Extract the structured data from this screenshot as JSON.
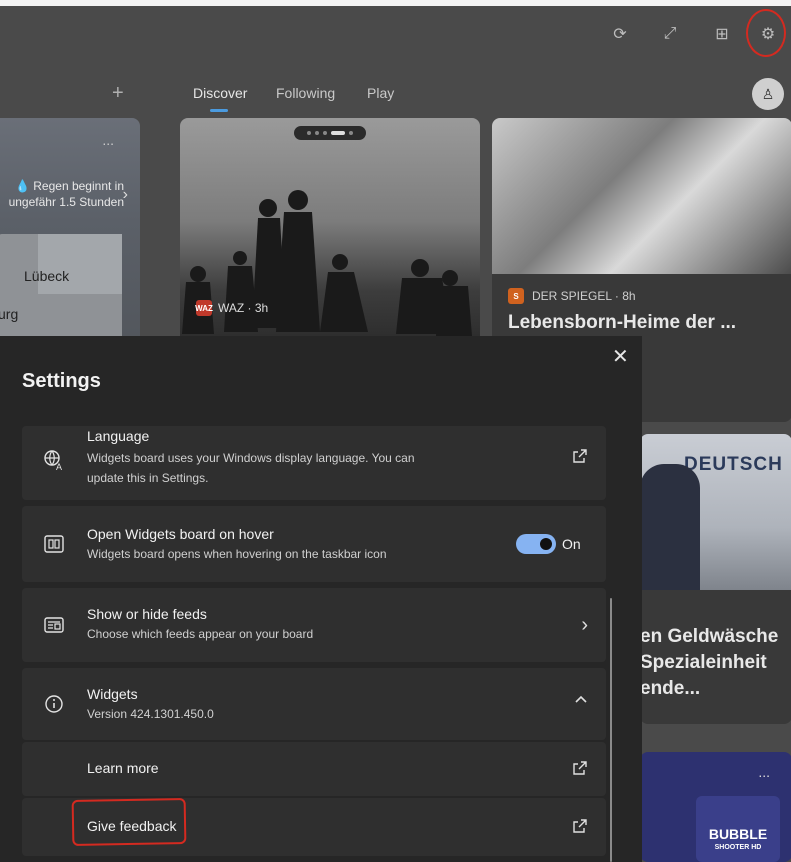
{
  "toolbar": {
    "icons": [
      "refresh-icon",
      "expand-icon",
      "widgets-icon",
      "gear-icon"
    ]
  },
  "tabs": [
    "Discover",
    "Following",
    "Play"
  ],
  "add_label": "+",
  "weather": {
    "rain_text_1": "💧 Regen beginnt in",
    "rain_text_2": "ungefähr 1.5 Stunden",
    "map_city": "Lübeck",
    "map_city2": "urg",
    "more": "..."
  },
  "photo_card": {
    "source_logo": "WAZ",
    "source": "WAZ · 3h"
  },
  "news_card": {
    "source_logo": "S",
    "source": "DER SPIEGEL · 8h",
    "title": "Lebensborn-Heime der ... eugen für"
  },
  "news2_card": {
    "image_text": "DEUTSCH",
    "title": "en Geldwäsche Spezialeinheit ende..."
  },
  "game_card": {
    "more": "...",
    "name": "BUBBLE",
    "name2": "SHOOTER",
    "badge": "HD"
  },
  "settings": {
    "title": "Settings",
    "close": "✕",
    "language": {
      "title": "Language",
      "desc": "Widgets board uses your Windows display language. You can update this in Settings."
    },
    "hover": {
      "title": "Open Widgets board on hover",
      "desc": "Widgets board opens when hovering on the taskbar icon",
      "toggle_label": "On",
      "toggle_on": true
    },
    "feeds": {
      "title": "Show or hide feeds",
      "desc": "Choose which feeds appear on your board"
    },
    "widgets": {
      "title": "Widgets",
      "version": "Version 424.1301.450.0"
    },
    "learn_more": "Learn more",
    "give_feedback": "Give feedback"
  },
  "colors": {
    "accent": "#86b3f2",
    "annotation_red": "#d42a20",
    "panel_bg": "#262626",
    "row_bg": "#2f2f2f"
  }
}
